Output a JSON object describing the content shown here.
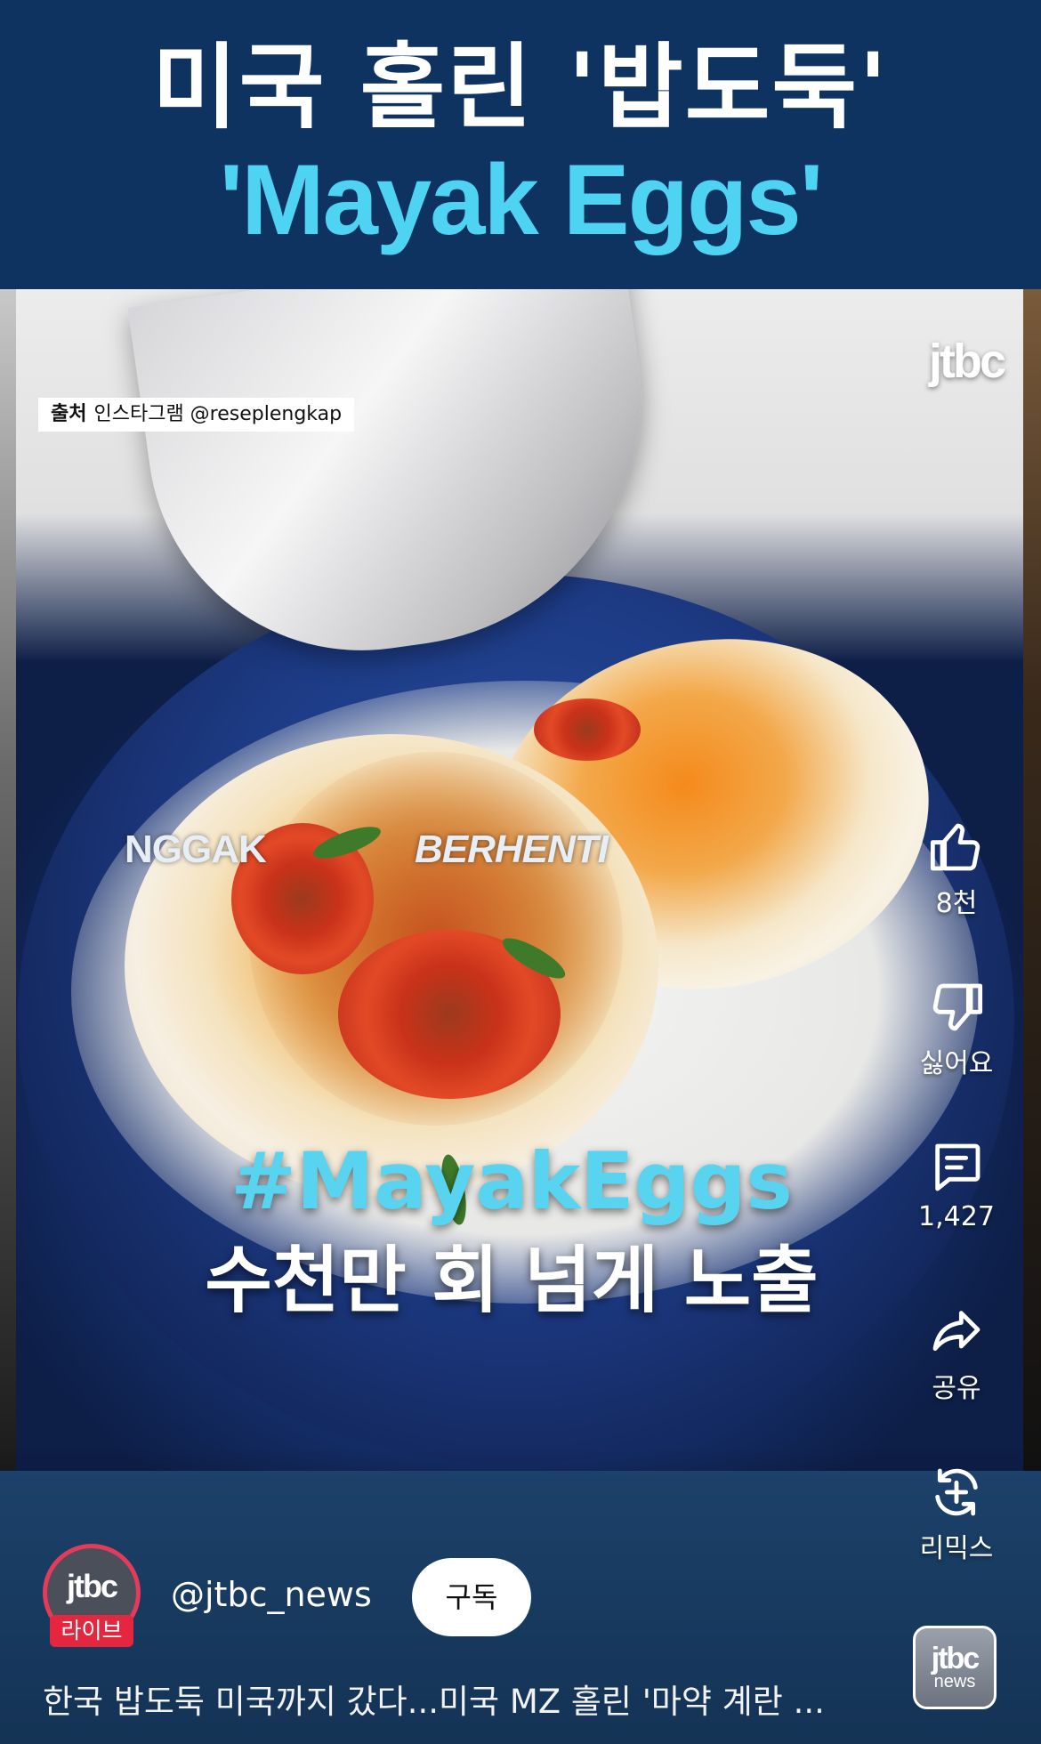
{
  "header": {
    "title_ko": "미국 홀린 '밥도둑'",
    "title_en": "'Mayak Eggs'"
  },
  "video": {
    "source_label_bold": "출처",
    "source_label": "인스타그램 @reseplengkap",
    "watermark": "jtbc",
    "overlay_text_1": "NGGAK",
    "overlay_text_2": "BERHENTI",
    "hashtag": "#MayakEggs",
    "subtitle": "수천만 회 넘게 노출"
  },
  "actions": {
    "like": {
      "icon": "thumbs-up-icon",
      "label": "8천"
    },
    "dislike": {
      "icon": "thumbs-down-icon",
      "label": "싫어요"
    },
    "comment": {
      "icon": "comment-icon",
      "label": "1,427"
    },
    "share": {
      "icon": "share-icon",
      "label": "공유"
    },
    "remix": {
      "icon": "remix-icon",
      "label": "리믹스"
    }
  },
  "channel": {
    "avatar_logo": "jtbc",
    "live_badge": "라이브",
    "handle": "@jtbc_news",
    "subscribe_label": "구독"
  },
  "description": "한국 밥도둑 미국까지 갔다...미국 MZ 홀린 '마약 계란 ...",
  "corner_logo": {
    "line1": "jtbc",
    "line2": "news"
  },
  "colors": {
    "header_bg": "#0f3361",
    "title_en": "#4fd3f2",
    "hashtag": "#58d4f0",
    "live_badge": "#e5263f",
    "info_bar": "#1c416a"
  }
}
